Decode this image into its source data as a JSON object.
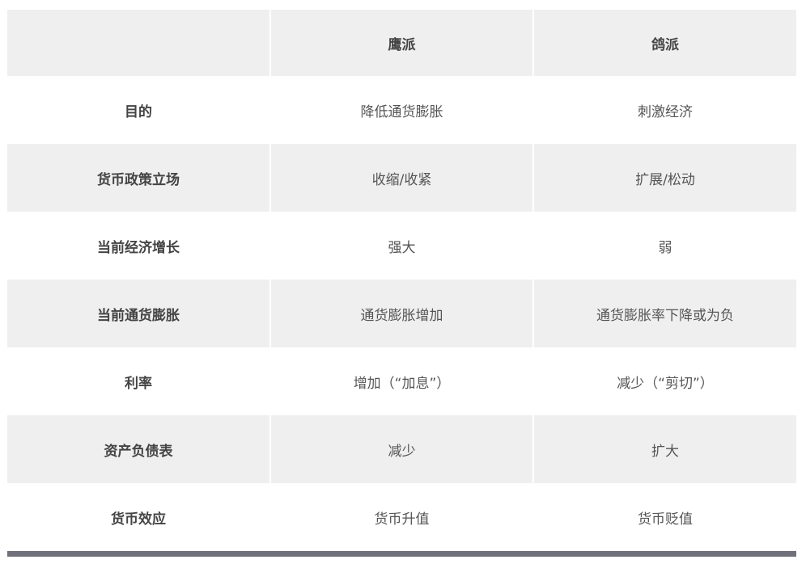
{
  "table": {
    "headers": [
      "",
      "鹰派",
      "鸽派"
    ],
    "rows": [
      {
        "label": "目的",
        "hawk": "降低通货膨胀",
        "dove": "刺激经济"
      },
      {
        "label": "货币政策立场",
        "hawk": "收缩/收紧",
        "dove": "扩展/松动"
      },
      {
        "label": "当前经济增长",
        "hawk": "强大",
        "dove": "弱"
      },
      {
        "label": "当前通货膨胀",
        "hawk": "通货膨胀增加",
        "dove": "通货膨胀率下降或为负"
      },
      {
        "label": "利率",
        "hawk": "增加（“加息”）",
        "dove": "减少（“剪切”）"
      },
      {
        "label": "资产负债表",
        "hawk": "减少",
        "dove": "扩大"
      },
      {
        "label": "货币效应",
        "hawk": "货币升值",
        "dove": "货币贬值"
      }
    ]
  }
}
